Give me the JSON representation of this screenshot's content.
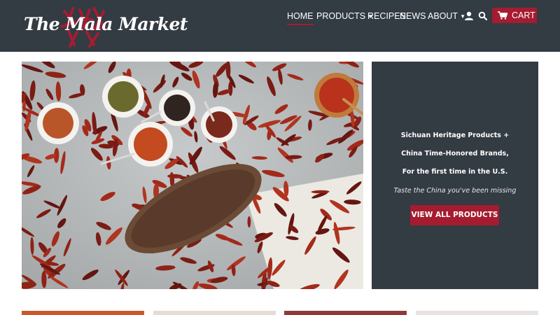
{
  "brand": {
    "name": "The Mala Market",
    "logo_mark_color": "#a51c30"
  },
  "nav": {
    "home": "HOME",
    "products": "PRODUCTS",
    "recipes": "RECIPES",
    "news": "NEWS",
    "about": "ABOUT",
    "cart": "CART",
    "account_icon": "user-icon",
    "search_icon": "search-icon",
    "cart_icon": "cart-icon"
  },
  "promo": {
    "line1": "Sichuan Heritage Products +",
    "line2": "China Time-Honored Brands,",
    "line3": "For the first time in the U.S.",
    "tagline": "Taste the China you've been missing",
    "button": "VIEW ALL PRODUCTS"
  },
  "colors": {
    "header_bg": "#333b43",
    "accent": "#a51c30",
    "panel_bg": "#333b43"
  }
}
